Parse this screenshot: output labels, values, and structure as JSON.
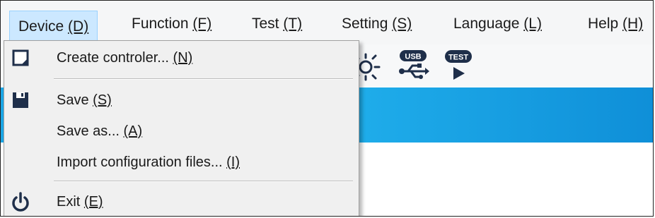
{
  "menubar": {
    "items": [
      {
        "pre": "Device ",
        "key": "(D)",
        "post": ""
      },
      {
        "pre": "Function ",
        "key": "(F)",
        "post": ""
      },
      {
        "pre": "Test ",
        "key": "(T)",
        "post": ""
      },
      {
        "pre": "Setting ",
        "key": "(S)",
        "post": ""
      },
      {
        "pre": "Language ",
        "key": "(L)",
        "post": ""
      },
      {
        "pre": "Help ",
        "key": "(H)",
        "post": ""
      }
    ]
  },
  "toolbar": {
    "icons": [
      "brightness-icon",
      "usb-icon",
      "test-play-icon"
    ],
    "usb_text": "USB",
    "test_text": "TEST"
  },
  "dropdown": {
    "items": [
      {
        "pre": "Create controler... ",
        "key": "(N)",
        "icon": "new-file-icon"
      },
      {
        "pre": "Save ",
        "key": "(S)",
        "icon": "floppy-disk-icon"
      },
      {
        "pre": "Save as... ",
        "key": "(A)",
        "icon": ""
      },
      {
        "pre": "Import configuration files... ",
        "key": "(I)",
        "icon": ""
      },
      {
        "pre": "Exit ",
        "key": "(E)",
        "icon": "power-icon"
      }
    ]
  },
  "colors": {
    "menu_active_bg": "#cce8ff",
    "band": "#1aa6e6",
    "icon_dark": "#1f2f4a"
  }
}
